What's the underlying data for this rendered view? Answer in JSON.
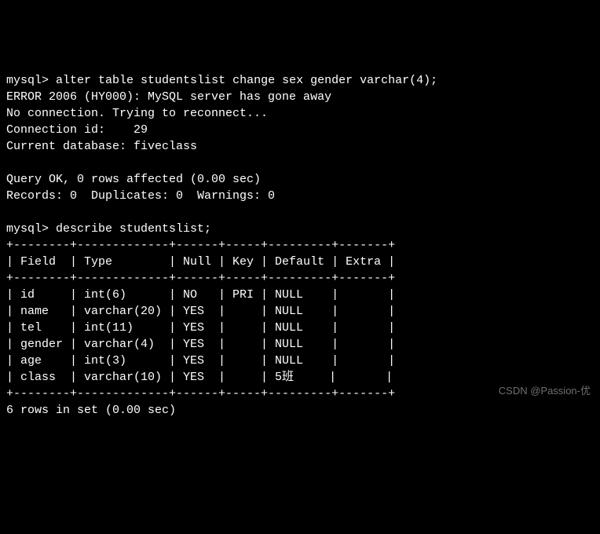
{
  "prompt": "mysql>",
  "cmd1": "alter table studentslist change sex gender varchar(4);",
  "err_line": "ERROR 2006 (HY000): MySQL server has gone away",
  "reconnect_line": "No connection. Trying to reconnect...",
  "conn_id_line": "Connection id:    29",
  "currdb_line": "Current database: fiveclass",
  "queryok_line": "Query OK, 0 rows affected (0.00 sec)",
  "records_line": "Records: 0  Duplicates: 0  Warnings: 0",
  "cmd2": "describe studentslist;",
  "table": {
    "border": "+--------+-------------+------+-----+---------+-------+",
    "header": "| Field  | Type        | Null | Key | Default | Extra |",
    "rows": [
      "| id     | int(6)      | NO   | PRI | NULL    |       |",
      "| name   | varchar(20) | YES  |     | NULL    |       |",
      "| tel    | int(11)     | YES  |     | NULL    |       |",
      "| gender | varchar(4)  | YES  |     | NULL    |       |",
      "| age    | int(3)      | YES  |     | NULL    |       |",
      "| class  | varchar(10) | YES  |     | 5班     |       |"
    ]
  },
  "summary_line": "6 rows in set (0.00 sec)",
  "watermark": "CSDN @Passion-优",
  "chart_data": {
    "type": "table",
    "title": "describe studentslist",
    "columns": [
      "Field",
      "Type",
      "Null",
      "Key",
      "Default",
      "Extra"
    ],
    "rows": [
      {
        "Field": "id",
        "Type": "int(6)",
        "Null": "NO",
        "Key": "PRI",
        "Default": "NULL",
        "Extra": ""
      },
      {
        "Field": "name",
        "Type": "varchar(20)",
        "Null": "YES",
        "Key": "",
        "Default": "NULL",
        "Extra": ""
      },
      {
        "Field": "tel",
        "Type": "int(11)",
        "Null": "YES",
        "Key": "",
        "Default": "NULL",
        "Extra": ""
      },
      {
        "Field": "gender",
        "Type": "varchar(4)",
        "Null": "YES",
        "Key": "",
        "Default": "NULL",
        "Extra": ""
      },
      {
        "Field": "age",
        "Type": "int(3)",
        "Null": "YES",
        "Key": "",
        "Default": "NULL",
        "Extra": ""
      },
      {
        "Field": "class",
        "Type": "varchar(10)",
        "Null": "YES",
        "Key": "",
        "Default": "5班",
        "Extra": ""
      }
    ]
  }
}
